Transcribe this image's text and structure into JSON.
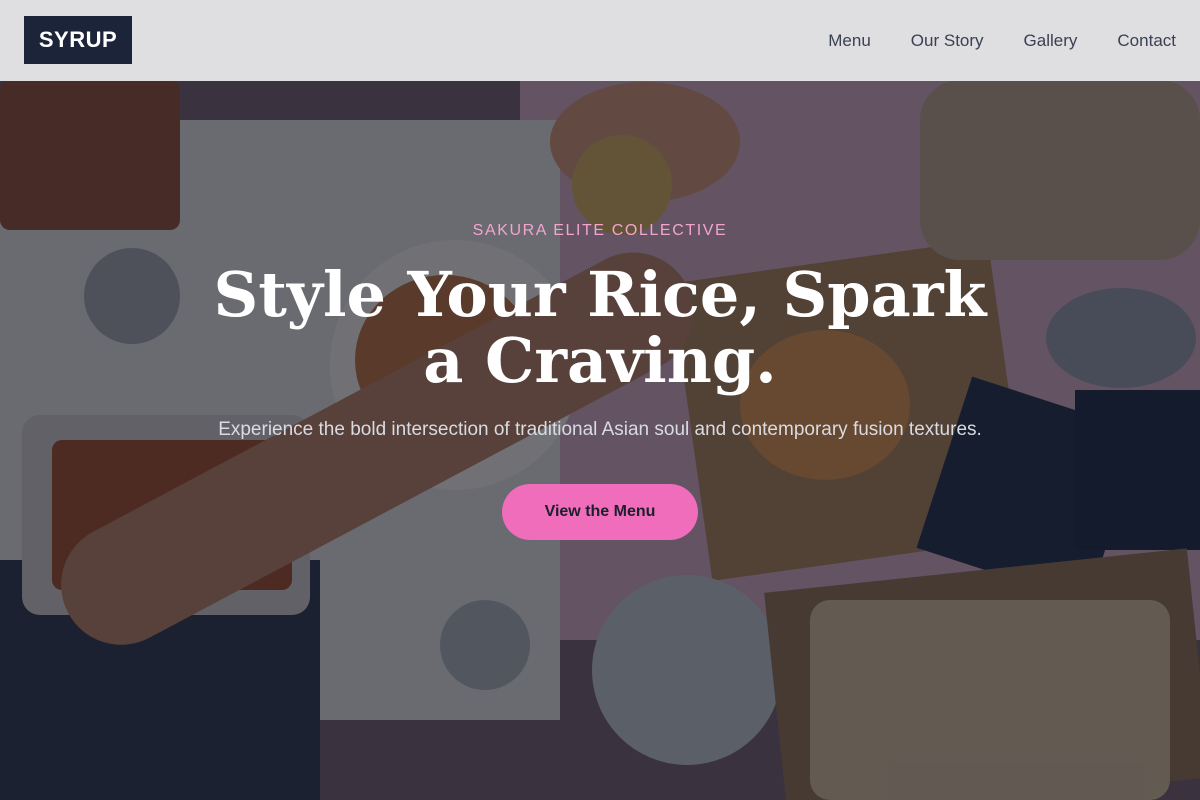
{
  "header": {
    "logo_text": "SYRUP",
    "nav": [
      {
        "label": "Menu"
      },
      {
        "label": "Our Story"
      },
      {
        "label": "Gallery"
      },
      {
        "label": "Contact"
      }
    ]
  },
  "hero": {
    "eyebrow": "SAKURA ELITE COLLECTIVE",
    "headline": "Style Your Rice, Spark a Craving.",
    "subtext": "Experience the bold intersection of traditional Asian soul and contemporary fusion textures.",
    "cta_label": "View the Menu",
    "background_image": "food-spread-photo"
  },
  "colors": {
    "accent": "#ef6dbb",
    "eyebrow": "#f2a4cf",
    "logo_bg": "#1b2438",
    "header_bg": "#ececee"
  }
}
